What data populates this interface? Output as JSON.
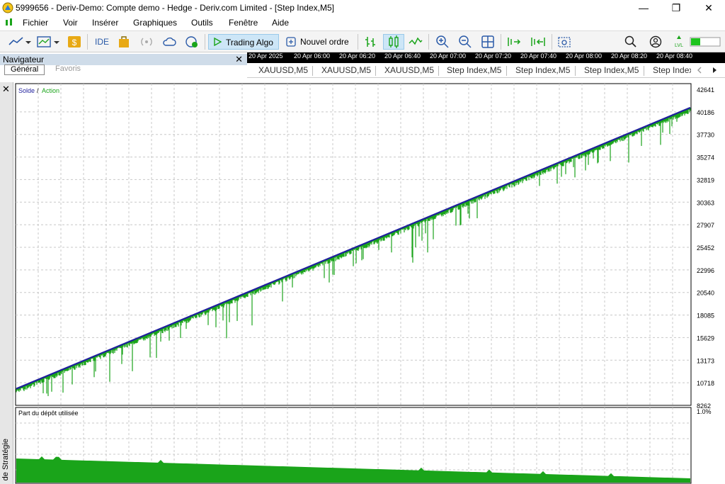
{
  "window": {
    "title": "5999656 - Deriv-Demo: Compte demo - Hedge - Deriv.com Limited - [Step Index,M5]",
    "minimize": "—",
    "maximize": "❐",
    "close": "✕"
  },
  "menu": [
    "Fichier",
    "Voir",
    "Insérer",
    "Graphiques",
    "Outils",
    "Fenêtre",
    "Aide"
  ],
  "toolbar": {
    "ide": "IDE",
    "trading_algo": "Trading Algo",
    "new_order": "Nouvel ordre"
  },
  "navigator": {
    "title": "Navigateur",
    "close": "✕",
    "tabs": [
      "Général",
      "Favoris"
    ]
  },
  "time_axis": [
    "20 Apr 2025",
    "20 Apr 06:00",
    "20 Apr 06:20",
    "20 Apr 06:40",
    "20 Apr 07:00",
    "20 Apr 07:20",
    "20 Apr 07:40",
    "20 Apr 08:00",
    "20 Apr 08:20",
    "20 Apr 08:40"
  ],
  "chart_tabs": [
    "XAUUSD,M5",
    "XAUUSD,M5",
    "XAUUSD,M5",
    "Step Index,M5",
    "Step Index,M5",
    "Step Index,M5",
    "Step Index"
  ],
  "strategy_panel": {
    "vertical_label": "de Stratégie",
    "close": "✕"
  },
  "balance_chart": {
    "legend_balance": "Solde",
    "legend_sep": "/",
    "legend_equity": "Action",
    "balance_color": "#1f1f9c",
    "equity_color": "#1aa41a"
  },
  "chart_data": [
    {
      "type": "line",
      "title": "",
      "series": [
        {
          "name": "Solde",
          "x": [
            0,
            1
          ],
          "y": [
            9900,
            40200
          ]
        },
        {
          "name": "Action",
          "x": [
            0,
            1
          ],
          "y": [
            9700,
            39900
          ]
        }
      ],
      "y_ticks": [
        "42641",
        "40186",
        "37730",
        "35274",
        "32819",
        "30363",
        "27907",
        "25452",
        "22996",
        "20540",
        "18085",
        "15629",
        "13173",
        "10718",
        "8262"
      ],
      "ylim": [
        8262,
        42641
      ],
      "grid": true
    },
    {
      "type": "area",
      "title": "Part du dépôt utilisée",
      "y_ticks": [
        "1.0%"
      ],
      "grid": true
    }
  ]
}
